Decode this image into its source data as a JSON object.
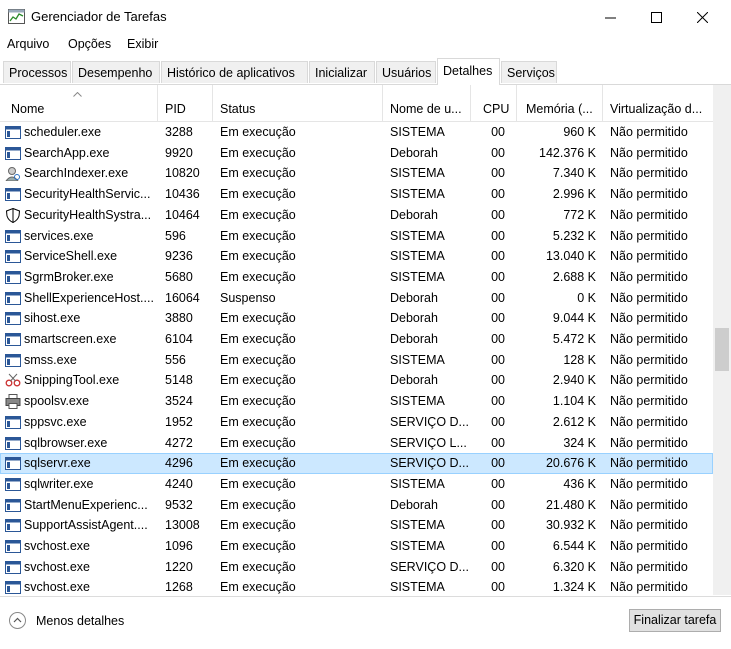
{
  "window": {
    "title": "Gerenciador de Tarefas"
  },
  "menu": [
    "Arquivo",
    "Opções",
    "Exibir"
  ],
  "tabs": [
    "Processos",
    "Desempenho",
    "Histórico de aplicativos",
    "Inicializar",
    "Usuários",
    "Detalhes",
    "Serviços"
  ],
  "active_tab": "Detalhes",
  "columns": [
    "Nome",
    "PID",
    "Status",
    "Nome de u...",
    "CPU",
    "Memória (...",
    "Virtualização d..."
  ],
  "rows": [
    {
      "icon": "app-window-icon",
      "name": "scheduler.exe",
      "pid": "3288",
      "status": "Em execução",
      "user": "SISTEMA",
      "cpu": "00",
      "mem": "960 K",
      "virt": "Não permitido"
    },
    {
      "icon": "app-window-icon",
      "name": "SearchApp.exe",
      "pid": "9920",
      "status": "Em execução",
      "user": "Deborah",
      "cpu": "00",
      "mem": "142.376 K",
      "virt": "Não permitido"
    },
    {
      "icon": "search-indexer-icon",
      "name": "SearchIndexer.exe",
      "pid": "10820",
      "status": "Em execução",
      "user": "SISTEMA",
      "cpu": "00",
      "mem": "7.340 K",
      "virt": "Não permitido"
    },
    {
      "icon": "app-window-icon",
      "name": "SecurityHealthServic...",
      "pid": "10436",
      "status": "Em execução",
      "user": "SISTEMA",
      "cpu": "00",
      "mem": "2.996 K",
      "virt": "Não permitido"
    },
    {
      "icon": "shield-icon",
      "name": "SecurityHealthSystra...",
      "pid": "10464",
      "status": "Em execução",
      "user": "Deborah",
      "cpu": "00",
      "mem": "772 K",
      "virt": "Não permitido"
    },
    {
      "icon": "app-window-icon",
      "name": "services.exe",
      "pid": "596",
      "status": "Em execução",
      "user": "SISTEMA",
      "cpu": "00",
      "mem": "5.232 K",
      "virt": "Não permitido"
    },
    {
      "icon": "app-window-icon",
      "name": "ServiceShell.exe",
      "pid": "9236",
      "status": "Em execução",
      "user": "SISTEMA",
      "cpu": "00",
      "mem": "13.040 K",
      "virt": "Não permitido"
    },
    {
      "icon": "app-window-icon",
      "name": "SgrmBroker.exe",
      "pid": "5680",
      "status": "Em execução",
      "user": "SISTEMA",
      "cpu": "00",
      "mem": "2.688 K",
      "virt": "Não permitido"
    },
    {
      "icon": "app-window-icon",
      "name": "ShellExperienceHost....",
      "pid": "16064",
      "status": "Suspenso",
      "user": "Deborah",
      "cpu": "00",
      "mem": "0 K",
      "virt": "Não permitido"
    },
    {
      "icon": "app-window-icon",
      "name": "sihost.exe",
      "pid": "3880",
      "status": "Em execução",
      "user": "Deborah",
      "cpu": "00",
      "mem": "9.044 K",
      "virt": "Não permitido"
    },
    {
      "icon": "app-window-icon",
      "name": "smartscreen.exe",
      "pid": "6104",
      "status": "Em execução",
      "user": "Deborah",
      "cpu": "00",
      "mem": "5.472 K",
      "virt": "Não permitido"
    },
    {
      "icon": "app-window-icon",
      "name": "smss.exe",
      "pid": "556",
      "status": "Em execução",
      "user": "SISTEMA",
      "cpu": "00",
      "mem": "128 K",
      "virt": "Não permitido"
    },
    {
      "icon": "snipping-tool-icon",
      "name": "SnippingTool.exe",
      "pid": "5148",
      "status": "Em execução",
      "user": "Deborah",
      "cpu": "00",
      "mem": "2.940 K",
      "virt": "Não permitido"
    },
    {
      "icon": "printer-icon",
      "name": "spoolsv.exe",
      "pid": "3524",
      "status": "Em execução",
      "user": "SISTEMA",
      "cpu": "00",
      "mem": "1.104 K",
      "virt": "Não permitido"
    },
    {
      "icon": "app-window-icon",
      "name": "sppsvc.exe",
      "pid": "1952",
      "status": "Em execução",
      "user": "SERVIÇO D...",
      "cpu": "00",
      "mem": "2.612 K",
      "virt": "Não permitido"
    },
    {
      "icon": "app-window-icon",
      "name": "sqlbrowser.exe",
      "pid": "4272",
      "status": "Em execução",
      "user": "SERVIÇO L...",
      "cpu": "00",
      "mem": "324 K",
      "virt": "Não permitido"
    },
    {
      "icon": "app-window-icon",
      "name": "sqlservr.exe",
      "pid": "4296",
      "status": "Em execução",
      "user": "SERVIÇO D...",
      "cpu": "00",
      "mem": "20.676 K",
      "virt": "Não permitido",
      "selected": true
    },
    {
      "icon": "app-window-icon",
      "name": "sqlwriter.exe",
      "pid": "4240",
      "status": "Em execução",
      "user": "SISTEMA",
      "cpu": "00",
      "mem": "436 K",
      "virt": "Não permitido"
    },
    {
      "icon": "app-window-icon",
      "name": "StartMenuExperienc...",
      "pid": "9532",
      "status": "Em execução",
      "user": "Deborah",
      "cpu": "00",
      "mem": "21.480 K",
      "virt": "Não permitido"
    },
    {
      "icon": "app-window-icon",
      "name": "SupportAssistAgent....",
      "pid": "13008",
      "status": "Em execução",
      "user": "SISTEMA",
      "cpu": "00",
      "mem": "30.932 K",
      "virt": "Não permitido"
    },
    {
      "icon": "app-window-icon",
      "name": "svchost.exe",
      "pid": "1096",
      "status": "Em execução",
      "user": "SISTEMA",
      "cpu": "00",
      "mem": "6.544 K",
      "virt": "Não permitido"
    },
    {
      "icon": "app-window-icon",
      "name": "svchost.exe",
      "pid": "1220",
      "status": "Em execução",
      "user": "SERVIÇO D...",
      "cpu": "00",
      "mem": "6.320 K",
      "virt": "Não permitido"
    },
    {
      "icon": "app-window-icon",
      "name": "svchost.exe",
      "pid": "1268",
      "status": "Em execução",
      "user": "SISTEMA",
      "cpu": "00",
      "mem": "1.324 K",
      "virt": "Não permitido"
    }
  ],
  "footer": {
    "less_details": "Menos detalhes",
    "end_task": "Finalizar tarefa"
  }
}
